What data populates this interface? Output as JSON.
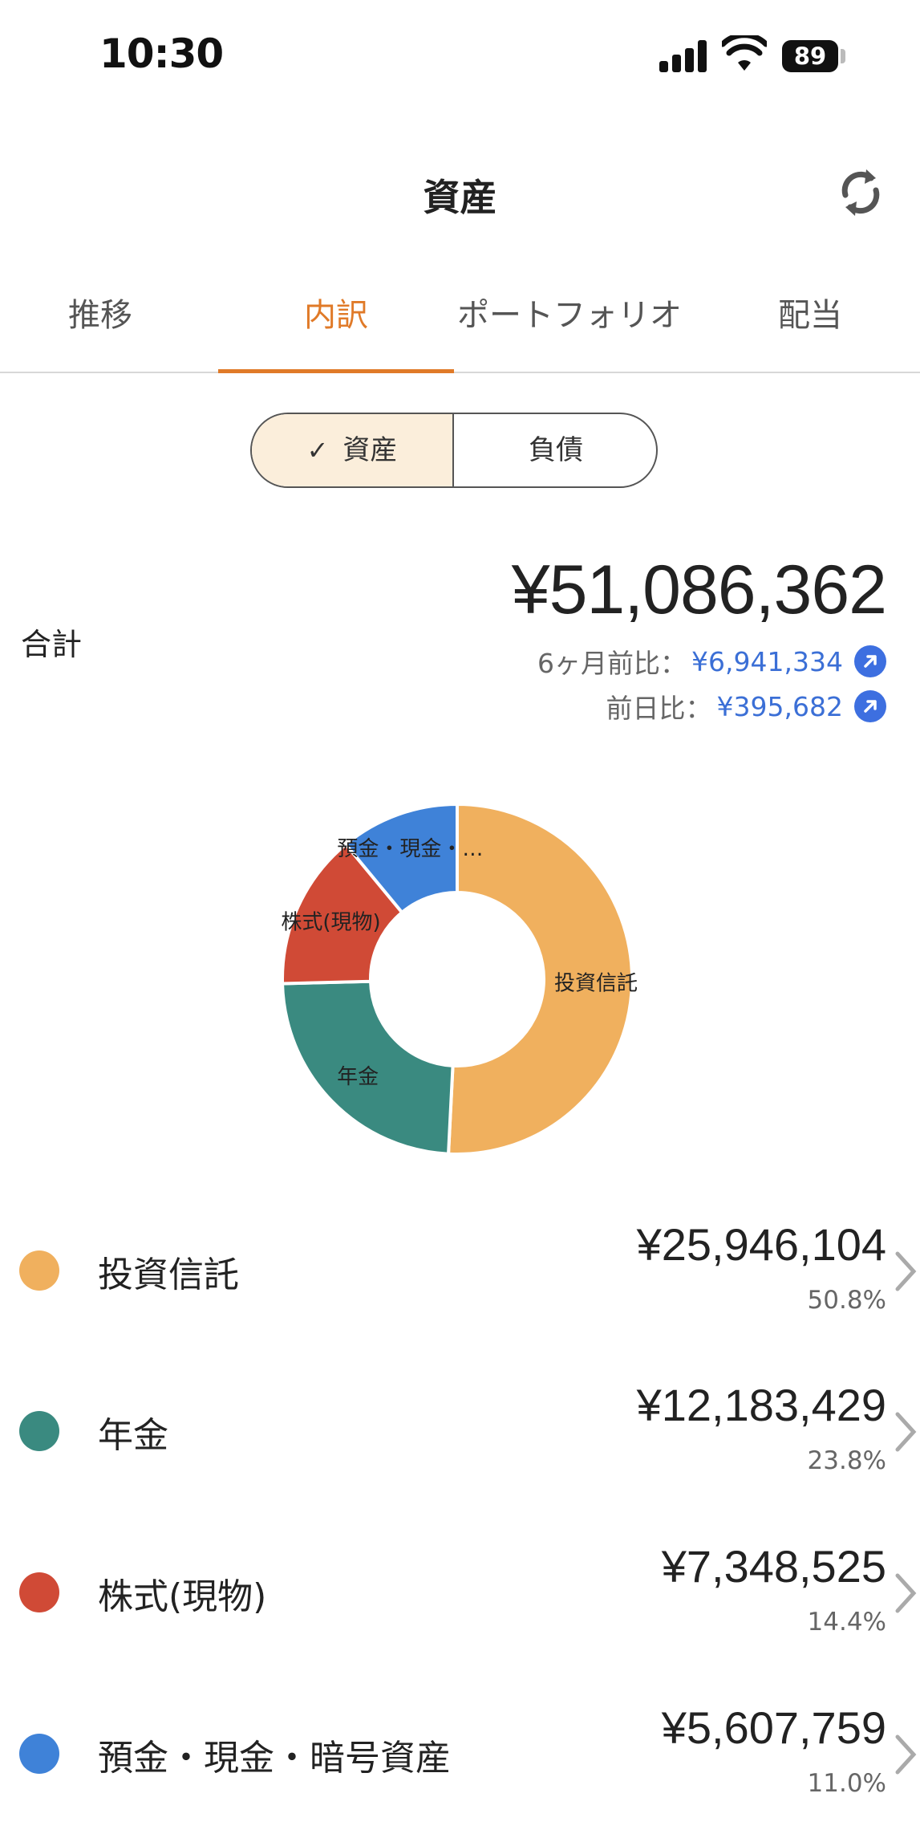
{
  "status_bar": {
    "time": "10:30",
    "battery": "89"
  },
  "header": {
    "title": "資産"
  },
  "tabs": [
    {
      "label": "推移"
    },
    {
      "label": "内訳"
    },
    {
      "label": "ポートフォリオ"
    },
    {
      "label": "配当"
    }
  ],
  "active_tab": "内訳",
  "segment": {
    "assets_label": "資産",
    "liabilities_label": "負債",
    "selected": "資産"
  },
  "summary": {
    "total_label": "合計",
    "total_value": "¥51,086,362",
    "six_month_label": "6ヶ月前比：",
    "six_month_value": "¥6,941,334",
    "prev_day_label": "前日比：",
    "prev_day_value": "¥395,682"
  },
  "chart_data": {
    "type": "pie",
    "donut": true,
    "categories": [
      "投資信託",
      "年金",
      "株式(現物)",
      "預金・現金・…"
    ],
    "values": [
      50.8,
      23.8,
      14.4,
      11.0
    ],
    "colors": [
      "#f0b05e",
      "#3a8a80",
      "#d04a36",
      "#3f82d8"
    ]
  },
  "categories": [
    {
      "name": "投資信託",
      "amount": "¥25,946,104",
      "percent": "50.8%",
      "color": "#f0b05e"
    },
    {
      "name": "年金",
      "amount": "¥12,183,429",
      "percent": "23.8%",
      "color": "#3a8a80"
    },
    {
      "name": "株式(現物)",
      "amount": "¥7,348,525",
      "percent": "14.4%",
      "color": "#d04a36"
    },
    {
      "name": "預金・現金・暗号資産",
      "amount": "¥5,607,759",
      "percent": "11.0%",
      "color": "#3f82d8"
    }
  ]
}
